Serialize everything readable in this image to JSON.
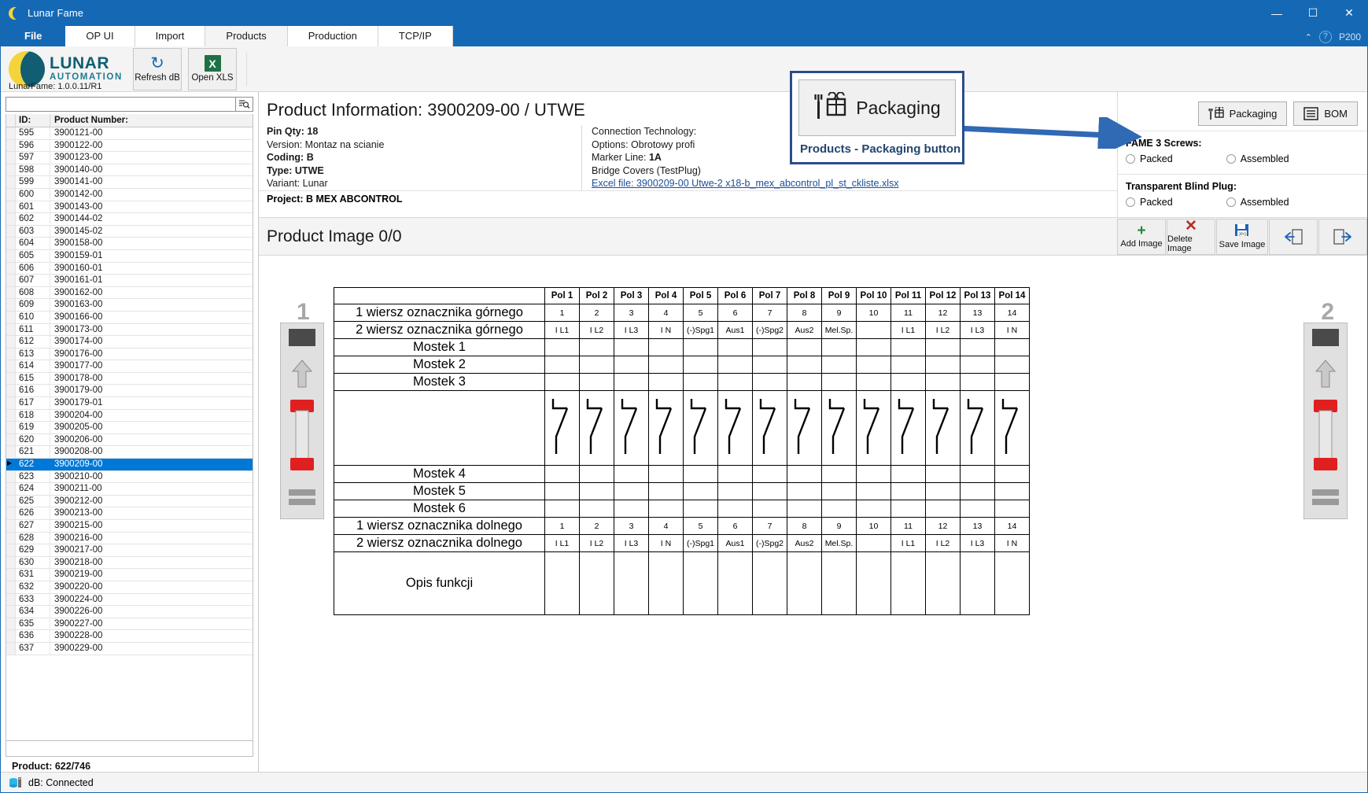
{
  "window": {
    "title": "Lunar Fame",
    "minimize": "—",
    "maximize": "☐",
    "close": "✕"
  },
  "ribbon": {
    "tabs": [
      {
        "label": "File",
        "state": "file"
      },
      {
        "label": "OP UI",
        "state": "inactive"
      },
      {
        "label": "Import",
        "state": "inactive"
      },
      {
        "label": "Products",
        "state": "selected"
      },
      {
        "label": "Production",
        "state": "inactive"
      },
      {
        "label": "TCP/IP",
        "state": "inactive"
      }
    ],
    "help_glyph": "?",
    "collapse_glyph": "⌃",
    "right_label": "P200",
    "brand_line1": "LUNAR",
    "brand_line2": "AUTOMATION",
    "version": "LunarFame: 1.0.0.11/R1",
    "buttons": [
      {
        "label": "Refresh dB",
        "icon": "refresh-icon",
        "glyph": "↻"
      },
      {
        "label": "Open XLS",
        "icon": "excel-icon",
        "glyph": "X"
      }
    ]
  },
  "list_panel": {
    "search": {
      "value": "",
      "placeholder": ""
    },
    "search_icon": "search-icon",
    "columns": [
      "ID:",
      "Product Number:"
    ],
    "rows": [
      {
        "id": "595",
        "pn": "3900121-00"
      },
      {
        "id": "596",
        "pn": "3900122-00"
      },
      {
        "id": "597",
        "pn": "3900123-00"
      },
      {
        "id": "598",
        "pn": "3900140-00"
      },
      {
        "id": "599",
        "pn": "3900141-00"
      },
      {
        "id": "600",
        "pn": "3900142-00"
      },
      {
        "id": "601",
        "pn": "3900143-00"
      },
      {
        "id": "602",
        "pn": "3900144-02"
      },
      {
        "id": "603",
        "pn": "3900145-02"
      },
      {
        "id": "604",
        "pn": "3900158-00"
      },
      {
        "id": "605",
        "pn": "3900159-01"
      },
      {
        "id": "606",
        "pn": "3900160-01"
      },
      {
        "id": "607",
        "pn": "3900161-01"
      },
      {
        "id": "608",
        "pn": "3900162-00"
      },
      {
        "id": "609",
        "pn": "3900163-00"
      },
      {
        "id": "610",
        "pn": "3900166-00"
      },
      {
        "id": "611",
        "pn": "3900173-00"
      },
      {
        "id": "612",
        "pn": "3900174-00"
      },
      {
        "id": "613",
        "pn": "3900176-00"
      },
      {
        "id": "614",
        "pn": "3900177-00"
      },
      {
        "id": "615",
        "pn": "3900178-00"
      },
      {
        "id": "616",
        "pn": "3900179-00"
      },
      {
        "id": "617",
        "pn": "3900179-01"
      },
      {
        "id": "618",
        "pn": "3900204-00"
      },
      {
        "id": "619",
        "pn": "3900205-00"
      },
      {
        "id": "620",
        "pn": "3900206-00"
      },
      {
        "id": "621",
        "pn": "3900208-00"
      },
      {
        "id": "622",
        "pn": "3900209-00",
        "selected": true
      },
      {
        "id": "623",
        "pn": "3900210-00"
      },
      {
        "id": "624",
        "pn": "3900211-00"
      },
      {
        "id": "625",
        "pn": "3900212-00"
      },
      {
        "id": "626",
        "pn": "3900213-00"
      },
      {
        "id": "627",
        "pn": "3900215-00"
      },
      {
        "id": "628",
        "pn": "3900216-00"
      },
      {
        "id": "629",
        "pn": "3900217-00"
      },
      {
        "id": "630",
        "pn": "3900218-00"
      },
      {
        "id": "631",
        "pn": "3900219-00"
      },
      {
        "id": "632",
        "pn": "3900220-00"
      },
      {
        "id": "633",
        "pn": "3900224-00"
      },
      {
        "id": "634",
        "pn": "3900226-00"
      },
      {
        "id": "635",
        "pn": "3900227-00"
      },
      {
        "id": "636",
        "pn": "3900228-00"
      },
      {
        "id": "637",
        "pn": "3900229-00"
      }
    ],
    "footer": "Product: 622/746"
  },
  "product_info": {
    "title": "Product Information: 3900209-00 / UTWE",
    "col1": [
      {
        "key": "Pin Qty:",
        "value": "18",
        "bold": true
      },
      {
        "key": "Version:",
        "value": "Montaz na scianie",
        "bold": false
      },
      {
        "key": "Coding:",
        "value": "B",
        "bold": true
      },
      {
        "key": "Type:",
        "value": "UTWE",
        "bold": true
      },
      {
        "key": "Variant:",
        "value": "Lunar",
        "bold": false
      }
    ],
    "col2": [
      {
        "key": "Connection Technology:",
        "value": ""
      },
      {
        "key": "Options:",
        "value": "Obrotowy profi"
      },
      {
        "key": "Marker Line:",
        "value": "1A"
      },
      {
        "key": "Bridge Covers (TestPlug)",
        "value": ""
      }
    ],
    "excel_link": "Excel file: 3900209-00 Utwe-2 x18-b_mex_abcontrol_pl_st_ckliste.xlsx",
    "project": "Project: B MEX ABCONTROL"
  },
  "right_panel": {
    "packaging_button": "Packaging",
    "bom_button": "BOM",
    "groups": [
      {
        "title": "FAME 3 Screws:",
        "options": [
          {
            "label": "Packed",
            "checked": false
          },
          {
            "label": "Assembled",
            "checked": false
          }
        ]
      },
      {
        "title": "Transparent Blind Plug:",
        "options": [
          {
            "label": "Packed",
            "checked": false
          },
          {
            "label": "Assembled",
            "checked": false
          }
        ]
      }
    ]
  },
  "image_toolbar": {
    "title": "Product Image 0/0",
    "buttons": [
      {
        "label": "Add Image",
        "icon": "plus-icon",
        "glyph": "＋"
      },
      {
        "label": "Delete Image",
        "icon": "cross-icon",
        "glyph": "✕"
      },
      {
        "label": "Save Image",
        "icon": "save-jpg-icon",
        "glyph": "💾"
      },
      {
        "label": "",
        "icon": "import-image-icon",
        "glyph": "↵"
      },
      {
        "label": "",
        "icon": "export-image-icon",
        "glyph": "↱"
      }
    ]
  },
  "callout": {
    "label": "Products - Packaging button",
    "button_text": "Packaging",
    "icon": "packaging-icon",
    "arrow_color": "#3069b4",
    "border_color": "#2b4d8c"
  },
  "status_bar": {
    "icon": "database-icon",
    "text": "dB: Connected"
  },
  "drawing": {
    "left_marker": "1",
    "right_marker": "2",
    "pol_headers": [
      "Pol 1",
      "Pol 2",
      "Pol 3",
      "Pol 4",
      "Pol 5",
      "Pol 6",
      "Pol 7",
      "Pol 8",
      "Pol 9",
      "Pol 10",
      "Pol 11",
      "Pol 12",
      "Pol 13",
      "Pol 14"
    ],
    "rows": [
      {
        "label": "1 wiersz oznacznika górnego",
        "cells": [
          "1",
          "2",
          "3",
          "4",
          "5",
          "6",
          "7",
          "8",
          "9",
          "10",
          "11",
          "12",
          "13",
          "14"
        ],
        "type": "num"
      },
      {
        "label": "2 wiersz oznacznika górnego",
        "cells": [
          "I L1",
          "I L2",
          "I L3",
          "I N",
          "(-)Spg1",
          "Aus1",
          "(-)Spg2",
          "Aus2",
          "Mel.Sp.",
          "",
          "I L1",
          "I L2",
          "I L3",
          "I N"
        ],
        "type": "sig"
      },
      {
        "label": "Mostek 1",
        "cells": [
          "",
          "",
          "",
          "",
          "",
          "",
          "",
          "",
          "",
          "",
          "",
          "",
          "",
          ""
        ],
        "type": "blank"
      },
      {
        "label": "Mostek 2",
        "cells": [
          "",
          "",
          "",
          "",
          "",
          "",
          "",
          "",
          "",
          "",
          "",
          "",
          "",
          ""
        ],
        "type": "blank"
      },
      {
        "label": "Mostek 3",
        "cells": [
          "",
          "",
          "",
          "",
          "",
          "",
          "",
          "",
          "",
          "",
          "",
          "",
          "",
          ""
        ],
        "type": "blank"
      },
      {
        "label": "",
        "cells": [
          "",
          "",
          "",
          "",
          "",
          "",
          "",
          "",
          "",
          "",
          "",
          "",
          "",
          ""
        ],
        "type": "symbol"
      },
      {
        "label": "Mostek 4",
        "cells": [
          "",
          "",
          "",
          "",
          "",
          "",
          "",
          "",
          "",
          "",
          "",
          "",
          "",
          ""
        ],
        "type": "blank"
      },
      {
        "label": "Mostek 5",
        "cells": [
          "",
          "",
          "",
          "",
          "",
          "",
          "",
          "",
          "",
          "",
          "",
          "",
          "",
          ""
        ],
        "type": "blank"
      },
      {
        "label": "Mostek 6",
        "cells": [
          "",
          "",
          "",
          "",
          "",
          "",
          "",
          "",
          "",
          "",
          "",
          "",
          "",
          ""
        ],
        "type": "blank"
      },
      {
        "label": "1 wiersz oznacznika dolnego",
        "cells": [
          "1",
          "2",
          "3",
          "4",
          "5",
          "6",
          "7",
          "8",
          "9",
          "10",
          "11",
          "12",
          "13",
          "14"
        ],
        "type": "num"
      },
      {
        "label": "2 wiersz oznacznika dolnego",
        "cells": [
          "I L1",
          "I L2",
          "I L3",
          "I N",
          "(-)Spg1",
          "Aus1",
          "(-)Spg2",
          "Aus2",
          "Mel.Sp.",
          "",
          "I L1",
          "I L2",
          "I L3",
          "I N"
        ],
        "type": "sig"
      },
      {
        "label": "Opis funkcji",
        "cells": [
          "",
          "",
          "",
          "",
          "",
          "",
          "",
          "",
          "",
          "",
          "",
          "",
          "",
          ""
        ],
        "type": "opis"
      }
    ]
  }
}
